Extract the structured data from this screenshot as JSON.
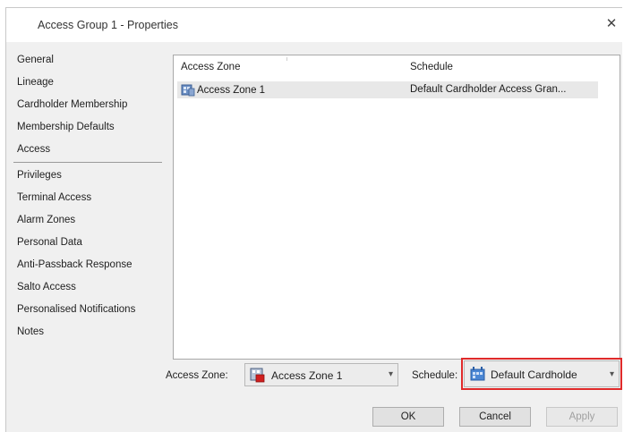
{
  "window": {
    "title": "Access Group 1 - Properties",
    "close_label": "✕"
  },
  "nav": {
    "items": [
      {
        "label": "General"
      },
      {
        "label": "Lineage"
      },
      {
        "label": "Cardholder Membership"
      },
      {
        "label": "Membership Defaults"
      },
      {
        "label": "Access"
      },
      {
        "label": "Privileges"
      },
      {
        "label": "Terminal Access"
      },
      {
        "label": "Alarm Zones"
      },
      {
        "label": "Personal Data"
      },
      {
        "label": "Anti-Passback Response"
      },
      {
        "label": "Salto Access"
      },
      {
        "label": "Personalised Notifications"
      },
      {
        "label": "Notes"
      }
    ],
    "selected": "Access"
  },
  "list": {
    "headers": [
      "Access Zone",
      "Schedule"
    ],
    "rows": [
      {
        "zone": "Access Zone 1",
        "schedule": "Default Cardholder Access Gran..."
      }
    ]
  },
  "bottom": {
    "zone_label": "Access Zone:",
    "zone_value": "Access Zone 1",
    "schedule_label": "Schedule:",
    "schedule_value": "Default Cardholde"
  },
  "buttons": {
    "ok": "OK",
    "cancel": "Cancel",
    "apply": "Apply"
  },
  "colors": {
    "highlight": "#e02a2a",
    "row_selected": "#e8e8e8",
    "panel": "#f0f0f0"
  }
}
